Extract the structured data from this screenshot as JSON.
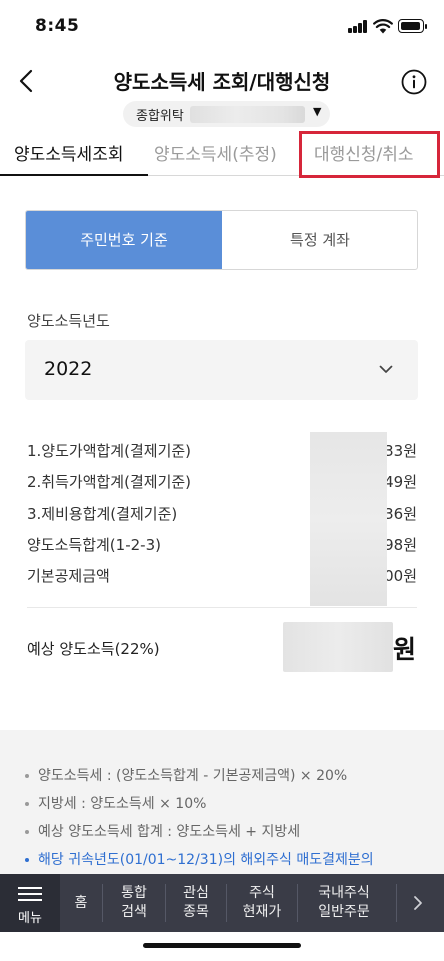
{
  "status_bar": {
    "time": "8:45"
  },
  "header": {
    "title": "양도소득세 조회/대행신청",
    "account_label": "종합위탁"
  },
  "tabs": [
    {
      "label": "양도소득세조회",
      "active": true
    },
    {
      "label": "양도소득세(추정)",
      "active": false
    },
    {
      "label": "대행신청/취소",
      "active": false
    }
  ],
  "segment": {
    "option_1": "주민번호 기준",
    "option_2": "특정 계좌",
    "selected": "주민번호 기준"
  },
  "year": {
    "label": "양도소득년도",
    "value": "2022"
  },
  "summary": {
    "rows": [
      {
        "label": "1.양도가액합계(결제기준)",
        "value": "33원"
      },
      {
        "label": "2.취득가액합계(결제기준)",
        "value": "49원"
      },
      {
        "label": "3.제비용합계(결제기준)",
        "value": "36원"
      },
      {
        "label": "양도소득합계(1-2-3)",
        "value": "98원"
      },
      {
        "label": "기본공제금액",
        "value": "00원"
      }
    ],
    "expected_label": "예상 양도소득(22%)",
    "expected_unit": "원"
  },
  "notes": [
    "양도소득세 : (양도소득합계 - 기본공제금액) × 20%",
    "지방세 : 양도소득세 × 10%",
    "예상 양도소득세 합계 : 양도소득세 + 지방세",
    "해당 귀속년도(01/01~12/31)의 해외주식 매도결제분의"
  ],
  "bottom_nav": {
    "menu": "메뉴",
    "items": [
      "홈",
      "통합\n검색",
      "관심\n종목",
      "주식\n현재가",
      "국내주식\n일반주문"
    ]
  },
  "colors": {
    "accent": "#5a8ed8",
    "highlight": "#d6263a",
    "link": "#2f6fd1",
    "nav_bg": "#3a3c47"
  }
}
